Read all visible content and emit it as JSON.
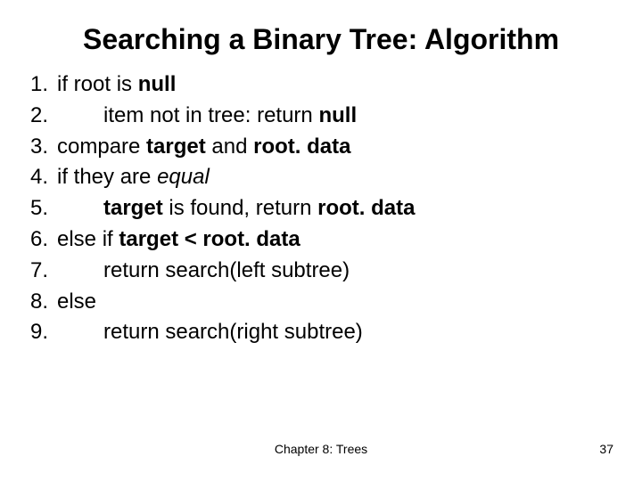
{
  "title": "Searching a Binary Tree: Algorithm",
  "steps": [
    {
      "num": "1.",
      "indent": false,
      "segments": [
        {
          "t": "if root is "
        },
        {
          "t": "null",
          "b": true
        }
      ]
    },
    {
      "num": "2.",
      "indent": true,
      "segments": [
        {
          "t": "item not in tree: return "
        },
        {
          "t": "null",
          "b": true
        }
      ]
    },
    {
      "num": "3.",
      "indent": false,
      "segments": [
        {
          "t": "compare "
        },
        {
          "t": "target",
          "b": true
        },
        {
          "t": " and "
        },
        {
          "t": "root. data",
          "b": true
        }
      ]
    },
    {
      "num": "4.",
      "indent": false,
      "segments": [
        {
          "t": "if they are "
        },
        {
          "t": "equal",
          "i": true
        }
      ]
    },
    {
      "num": "5.",
      "indent": true,
      "segments": [
        {
          "t": "target",
          "b": true
        },
        {
          "t": " is found, return "
        },
        {
          "t": "root. data",
          "b": true
        }
      ]
    },
    {
      "num": "6.",
      "indent": false,
      "segments": [
        {
          "t": "else if "
        },
        {
          "t": "target < root. data",
          "b": true
        }
      ]
    },
    {
      "num": "7.",
      "indent": true,
      "segments": [
        {
          "t": "return search(left subtree)"
        }
      ]
    },
    {
      "num": "8.",
      "indent": false,
      "segments": [
        {
          "t": "else"
        }
      ]
    },
    {
      "num": "9.",
      "indent": true,
      "segments": [
        {
          "t": "return search(right subtree)"
        }
      ]
    }
  ],
  "footer": {
    "center": "Chapter 8: Trees",
    "page": "37"
  }
}
